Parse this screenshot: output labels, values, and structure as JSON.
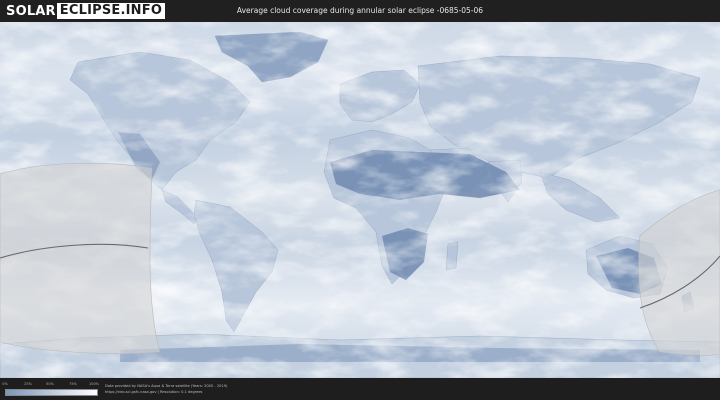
{
  "header": {
    "logo_part1": "SOLAR",
    "logo_part2": "ECLIPSE.INFO",
    "title": "Average cloud coverage during annular solar eclipse -0685-05-06"
  },
  "map": {
    "type": "equirectangular world map with cloud coverage overlay",
    "colors": {
      "clear_sky": "#7b95b9",
      "overcast": "#ffffff",
      "eclipse_zone": "#d8d8d8",
      "central_line": "#666666"
    }
  },
  "footer": {
    "legend_ticks": [
      "0%",
      "25%",
      "50%",
      "75%",
      "100%"
    ],
    "credit_line1": "Data provided by NASA's Aqua & Terra satellite (Years: 2000 - 2019)",
    "credit_line2": "https://neo.sci.gsfc.nasa.gov | Resolution: 0.1 degrees"
  }
}
